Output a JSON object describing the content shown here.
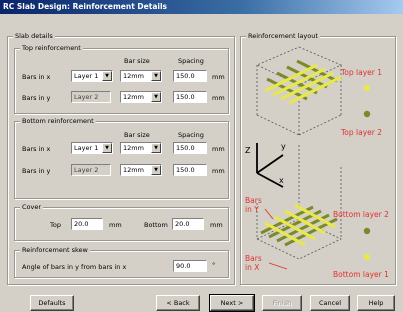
{
  "window": {
    "title": "RC Slab Design: Reinforcement Details"
  },
  "slab_details": {
    "title": "Slab details",
    "top": {
      "title": "Top reinforcement",
      "col_bar_size": "Bar size",
      "col_spacing": "Spacing",
      "row_x_label": "Bars in x",
      "row_x_layer": "Layer 1",
      "row_x_bar": "12mm",
      "row_x_spacing": "150.0",
      "row_y_label": "Bars in y",
      "row_y_layer": "Layer 2",
      "row_y_bar": "12mm",
      "row_y_spacing": "150.0",
      "unit": "mm"
    },
    "bottom": {
      "title": "Bottom reinforcement",
      "col_bar_size": "Bar size",
      "col_spacing": "Spacing",
      "row_x_label": "Bars in x",
      "row_x_layer": "Layer 1",
      "row_x_bar": "12mm",
      "row_x_spacing": "150.0",
      "row_y_label": "Bars in y",
      "row_y_layer": "Layer 2",
      "row_y_bar": "12mm",
      "row_y_spacing": "150.0",
      "unit": "mm"
    },
    "cover": {
      "title": "Cover",
      "top_label": "Top",
      "top_value": "20.0",
      "bottom_label": "Bottom",
      "bottom_value": "20.0",
      "unit": "mm"
    },
    "skew": {
      "title": "Reinforcement skew",
      "label": "Angle of bars in y from bars in x",
      "value": "90.0",
      "unit": "°"
    }
  },
  "layout_panel": {
    "title": "Reinforcement layout",
    "top_layer_1": "Top layer 1",
    "top_layer_2": "Top layer 2",
    "bottom_layer_2": "Bottom layer 2",
    "bottom_layer_1": "Bottom layer 1",
    "bars_in_y": [
      "Bars",
      "in Y"
    ],
    "bars_in_x": [
      "Bars",
      "in X"
    ],
    "axis_z": "Z",
    "axis_y": "y",
    "axis_x": "x",
    "colors": {
      "yellow": "#e8e84a",
      "green": "#7a8a2a",
      "red": "#e03030"
    }
  },
  "buttons": {
    "defaults": "Defaults",
    "back": "< Back",
    "next": "Next >",
    "finish": "Finish",
    "cancel": "Cancel",
    "help": "Help"
  }
}
